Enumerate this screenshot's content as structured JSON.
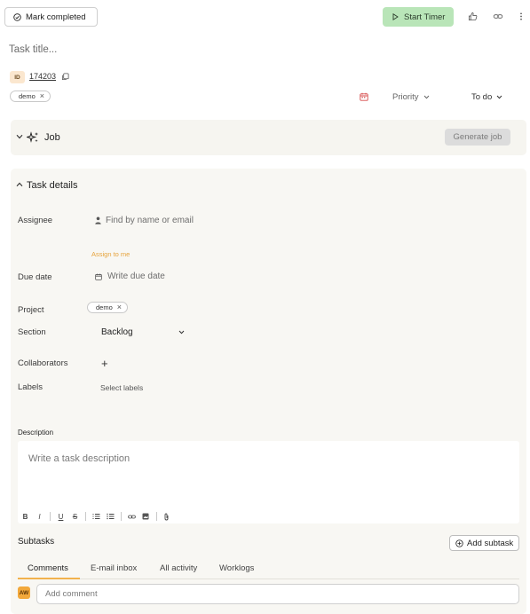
{
  "header": {
    "mark_completed_label": "Mark completed",
    "start_timer_label": "Start Timer",
    "icons": [
      "check-circle-icon",
      "play-icon",
      "thumbs-up-icon",
      "link-icon",
      "more-vertical-icon"
    ]
  },
  "task": {
    "title_placeholder": "Task title...",
    "id_badge": "ID",
    "id_number": "174203",
    "tags": [
      "demo"
    ],
    "priority_label": "Priority",
    "status_label": "To do"
  },
  "job": {
    "label": "Job",
    "generate_label": "Generate job"
  },
  "details": {
    "heading": "Task details",
    "assignee_label": "Assignee",
    "assignee_placeholder": "Find by name or email",
    "assign_to_me": "Assign to me",
    "due_date_label": "Due date",
    "due_date_placeholder": "Write due date",
    "project_label": "Project",
    "project_tag": "demo",
    "section_label": "Section",
    "section_value": "Backlog",
    "collaborators_label": "Collaborators",
    "collaborators_add": "+",
    "labels_label": "Labels",
    "labels_placeholder": "Select labels"
  },
  "description": {
    "label": "Description",
    "placeholder": "Write a task description",
    "toolbar": [
      "B",
      "I",
      "U",
      "S"
    ]
  },
  "subtasks": {
    "label": "Subtasks",
    "add_label": "Add subtask"
  },
  "tabs": [
    {
      "label": "Comments",
      "active": true
    },
    {
      "label": "E-mail inbox",
      "active": false
    },
    {
      "label": "All activity",
      "active": false
    },
    {
      "label": "Worklogs",
      "active": false
    }
  ],
  "comment": {
    "avatar_initials": "AW",
    "placeholder": "Add comment"
  },
  "colors": {
    "timer_bg": "#b9e5b8",
    "accent_orange": "#f2b24d",
    "assign_link": "#e6a33c",
    "card_bg": "#f6f5f0"
  }
}
